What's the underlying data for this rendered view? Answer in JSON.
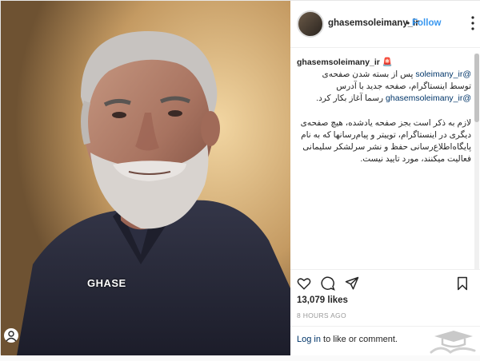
{
  "header": {
    "username": "ghasemsoleimany_ir",
    "separator": "•",
    "follow_label": "Follow"
  },
  "photo": {
    "watermark_text": "GHASE"
  },
  "caption": {
    "username": "ghasemsoleimany_ir",
    "username_emoji": "🚨",
    "mention_1": "@soleimany_ir",
    "line_1": "پس از بسته شدن صفحه‌ی",
    "line_2": "توسط اینستاگرام، صفحه جدید با آدرس",
    "mention_2": "@ghasemsoleimany_ir",
    "line_3": "رسما آغاز بکار کرد.",
    "paragraph_2": "لازم به ذکر است بجز صفحه یادشده، هیچ صفحه‌ی دیگری در اینستاگرام، توییتر و پیام‌رسانها که به نام پایگاه‌اطلاع‌رسانی حفظ و نشر سرلشکر سلیمانی فعالیت میکنند، مورد تایید نیست."
  },
  "stats": {
    "likes": "13,079 likes",
    "date": "8 HOURS AGO"
  },
  "footer": {
    "login_link": "Log in",
    "login_rest": " to like or comment."
  },
  "icons": {
    "heart": "heart-icon",
    "comment": "comment-icon",
    "share": "share-icon",
    "bookmark": "bookmark-icon",
    "more": "more-options-icon"
  },
  "colors": {
    "link": "#3897f0",
    "mention": "#003569",
    "text": "#262626",
    "muted": "#999999"
  }
}
